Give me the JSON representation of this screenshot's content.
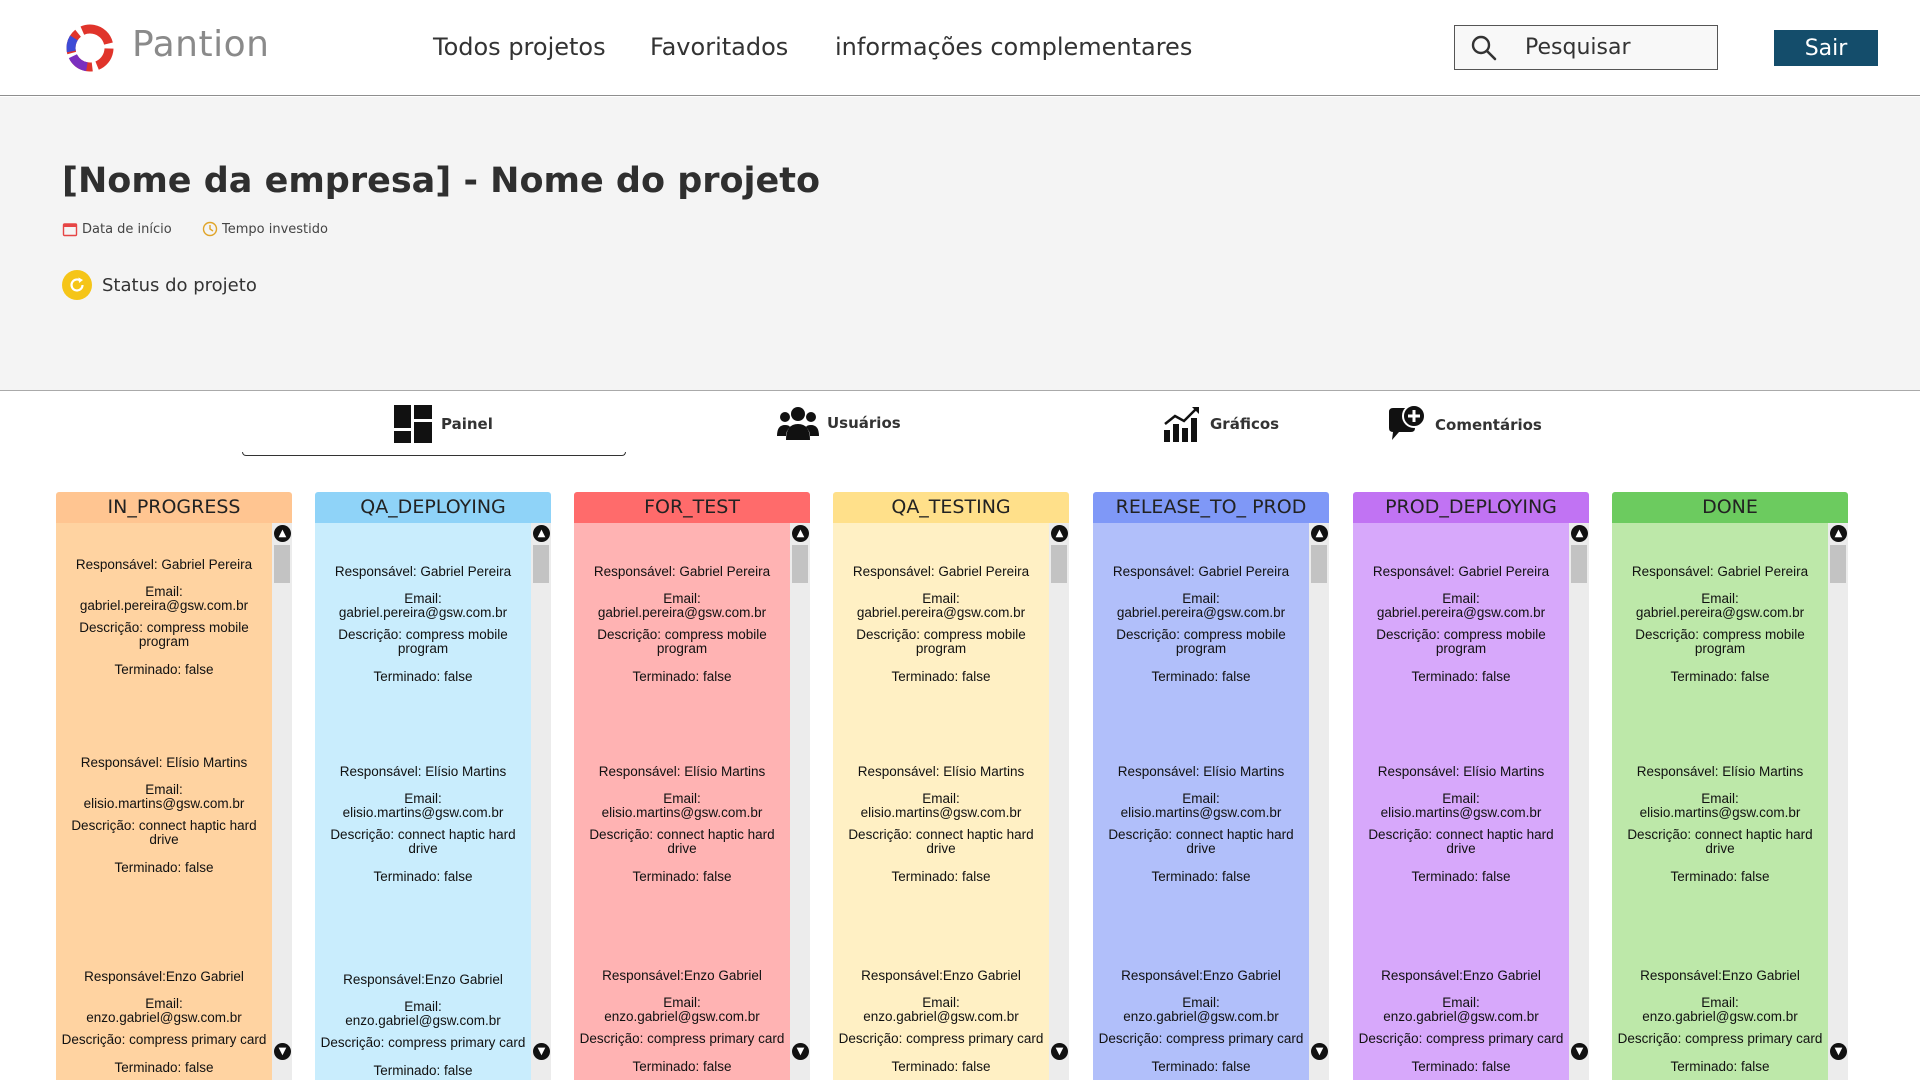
{
  "brand": {
    "name": "Pantion"
  },
  "nav": {
    "links": [
      "Todos projetos",
      "Favoritados",
      "informações complementares"
    ],
    "search_placeholder": "Pesquisar",
    "logout_label": "Sair"
  },
  "project": {
    "title": "[Nome da empresa] - Nome do projeto",
    "start_date_label": "Data de início",
    "time_label": "Tempo investido",
    "status_label": "Status  do projeto"
  },
  "tabs": [
    {
      "label": "Painel",
      "icon": "dashboard-icon",
      "active": true
    },
    {
      "label": "Usuários",
      "icon": "users-icon",
      "active": false
    },
    {
      "label": "Gráficos",
      "icon": "chart-icon",
      "active": false
    },
    {
      "label": "Comentários",
      "icon": "add-comment-icon",
      "active": false
    }
  ],
  "columns": [
    {
      "title": "IN_PROGRESS",
      "header_color": "#ffc591",
      "body_color": "#ffd3a1",
      "cards": [
        {
          "responsible": "Responsável: Gabriel Pereira",
          "email_label": "Email:",
          "email": "gabriel.pereira@gsw.com.br",
          "description": "Descrição: compress mobile program",
          "finished": "Terminado: false"
        },
        {
          "responsible": "Responsável: Elísio Martins",
          "email_label": "Email:",
          "email": "elisio.martins@gsw.com.br",
          "description": "Descrição: connect haptic hard drive",
          "finished": "Terminado: false"
        },
        {
          "responsible": "Responsável:Enzo Gabriel",
          "email_label": "Email:",
          "email": "enzo.gabriel@gsw.com.br",
          "description": "Descrição: compress primary card",
          "finished": "Terminado: false"
        }
      ]
    },
    {
      "title": "QA_DEPLOYING",
      "header_color": "#8fd3f8",
      "body_color": "#c9edfd",
      "cards": [
        {
          "responsible": "Responsável: Gabriel Pereira",
          "email_label": "Email:",
          "email": "gabriel.pereira@gsw.com.br",
          "description": "Descrição: compress mobile program",
          "finished": "Terminado: false"
        },
        {
          "responsible": "Responsável: Elísio Martins",
          "email_label": "Email:",
          "email": "elisio.martins@gsw.com.br",
          "description": "Descrição: connect haptic hard drive",
          "finished": "Terminado: false"
        },
        {
          "responsible": "Responsável:Enzo Gabriel",
          "email_label": "Email:",
          "email": "enzo.gabriel@gsw.com.br",
          "description": "Descrição: compress primary card",
          "finished": "Terminado: false"
        }
      ]
    },
    {
      "title": "FOR_TEST",
      "header_color": "#ff6b6b",
      "body_color": "#ffb3b3",
      "cards": [
        {
          "responsible": "Responsável: Gabriel Pereira",
          "email_label": "Email:",
          "email": "gabriel.pereira@gsw.com.br",
          "description": "Descrição: compress mobile program",
          "finished": "Terminado: false"
        },
        {
          "responsible": "Responsável: Elísio Martins",
          "email_label": "Email:",
          "email": "elisio.martins@gsw.com.br",
          "description": "Descrição: connect haptic hard drive",
          "finished": "Terminado: false"
        },
        {
          "responsible": "Responsável:Enzo Gabriel",
          "email_label": "Email:",
          "email": "enzo.gabriel@gsw.com.br",
          "description": "Descrição: compress primary card",
          "finished": "Terminado: false"
        }
      ]
    },
    {
      "title": "QA_TESTING",
      "header_color": "#ffe08a",
      "body_color": "#fff0c4",
      "cards": [
        {
          "responsible": "Responsável: Gabriel Pereira",
          "email_label": "Email:",
          "email": "gabriel.pereira@gsw.com.br",
          "description": "Descrição: compress mobile program",
          "finished": "Terminado: false"
        },
        {
          "responsible": "Responsável: Elísio Martins",
          "email_label": "Email:",
          "email": "elisio.martins@gsw.com.br",
          "description": "Descrição: connect haptic hard drive",
          "finished": "Terminado: false"
        },
        {
          "responsible": "Responsável:Enzo Gabriel",
          "email_label": "Email:",
          "email": "enzo.gabriel@gsw.com.br",
          "description": "Descrição: compress primary card",
          "finished": "Terminado: false"
        }
      ]
    },
    {
      "title": "RELEASE_TO_ PROD",
      "header_color": "#7f98f7",
      "body_color": "#b1bffa",
      "cards": [
        {
          "responsible": "Responsável: Gabriel Pereira",
          "email_label": "Email:",
          "email": "gabriel.pereira@gsw.com.br",
          "description": "Descrição: compress mobile program",
          "finished": "Terminado: false"
        },
        {
          "responsible": "Responsável: Elísio Martins",
          "email_label": "Email:",
          "email": "elisio.martins@gsw.com.br",
          "description": "Descrição: connect haptic hard drive",
          "finished": "Terminado: false"
        },
        {
          "responsible": "Responsável:Enzo Gabriel",
          "email_label": "Email:",
          "email": "enzo.gabriel@gsw.com.br",
          "description": "Descrição: compress primary card",
          "finished": "Terminado: false"
        }
      ]
    },
    {
      "title": "PROD_DEPLOYING",
      "header_color": "#c173f3",
      "body_color": "#d7a8fb",
      "cards": [
        {
          "responsible": "Responsável: Gabriel Pereira",
          "email_label": "Email:",
          "email": "gabriel.pereira@gsw.com.br",
          "description": "Descrição: compress mobile program",
          "finished": "Terminado: false"
        },
        {
          "responsible": "Responsável: Elísio Martins",
          "email_label": "Email:",
          "email": "elisio.martins@gsw.com.br",
          "description": "Descrição: connect haptic hard drive",
          "finished": "Terminado: false"
        },
        {
          "responsible": "Responsável:Enzo Gabriel",
          "email_label": "Email:",
          "email": "enzo.gabriel@gsw.com.br",
          "description": "Descrição: compress primary card",
          "finished": "Terminado: false"
        }
      ]
    },
    {
      "title": "DONE",
      "header_color": "#6ccb5f",
      "body_color": "#bde8a9",
      "cards": [
        {
          "responsible": "Responsável: Gabriel Pereira",
          "email_label": "Email:",
          "email": "gabriel.pereira@gsw.com.br",
          "description": "Descrição: compress mobile program",
          "finished": "Terminado: false"
        },
        {
          "responsible": "Responsável: Elísio Martins",
          "email_label": "Email:",
          "email": "elisio.martins@gsw.com.br",
          "description": "Descrição: connect haptic hard drive",
          "finished": "Terminado: false"
        },
        {
          "responsible": "Responsável:Enzo Gabriel",
          "email_label": "Email:",
          "email": "enzo.gabriel@gsw.com.br",
          "description": "Descrição: compress primary card",
          "finished": "Terminado: false"
        }
      ]
    }
  ]
}
